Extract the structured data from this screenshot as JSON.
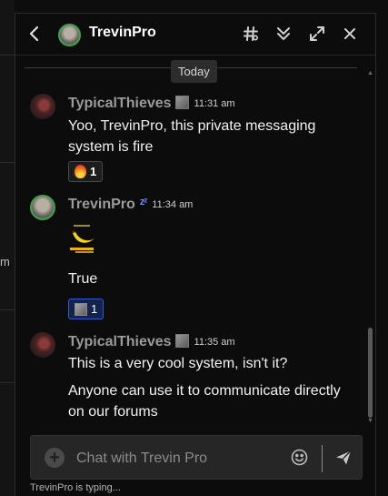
{
  "header": {
    "title": "TrevinPro",
    "icons": [
      "back-icon",
      "hashtag-icon",
      "double-chevron-down-icon",
      "expand-icon",
      "close-icon"
    ]
  },
  "background": {
    "fragment": "m"
  },
  "date_divider": "Today",
  "messages": [
    {
      "author": "TypicalThieves",
      "time": "11:31 am",
      "paragraphs": [
        "Yoo, TrevinPro, this private messaging system is fire"
      ],
      "reaction": {
        "emoji": "fire-emoji",
        "count": "1"
      }
    },
    {
      "author": "TrevinPro",
      "status_icon": "zzz",
      "time": "11:34 am",
      "sticker": "banana-sticker",
      "paragraphs": [
        "True"
      ],
      "reaction": {
        "emoji": "avatar-emoji",
        "count": "1",
        "active": true
      }
    },
    {
      "author": "TypicalThieves",
      "time": "11:35 am",
      "paragraphs": [
        "This is a very cool system, isn't it?",
        "Anyone can use it to communicate directly on our forums"
      ]
    }
  ],
  "composer": {
    "placeholder": "Chat with Trevin Pro",
    "value": ""
  },
  "typing_indicator": "TrevinPro is typing...",
  "colors": {
    "online_ring": "#3fa34d",
    "active_reaction_border": "#2f5bd0",
    "active_reaction_bg": "#12244a",
    "zzz": "#6c8cff"
  }
}
